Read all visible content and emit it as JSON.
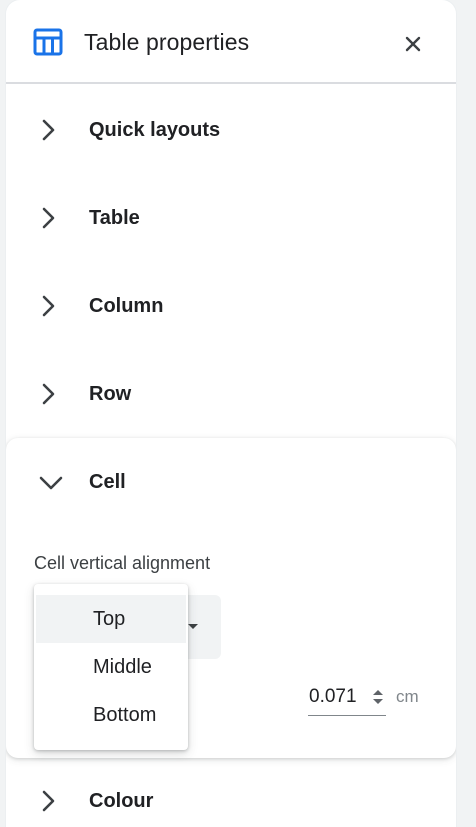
{
  "header": {
    "title": "Table properties",
    "icon": "table-icon",
    "close_icon": "close-icon",
    "accent_color": "#1a73e8"
  },
  "sections": [
    {
      "label": "Quick layouts",
      "expanded": false
    },
    {
      "label": "Table",
      "expanded": false
    },
    {
      "label": "Column",
      "expanded": false
    },
    {
      "label": "Row",
      "expanded": false
    },
    {
      "label": "Cell",
      "expanded": true
    },
    {
      "label": "Colour",
      "expanded": false
    }
  ],
  "cell": {
    "vertical_alignment_label": "Cell vertical alignment",
    "selected_alignment": "Top",
    "alignment_options": [
      "Top",
      "Middle",
      "Bottom"
    ],
    "padding_value": "0.071",
    "padding_unit": "cm"
  }
}
